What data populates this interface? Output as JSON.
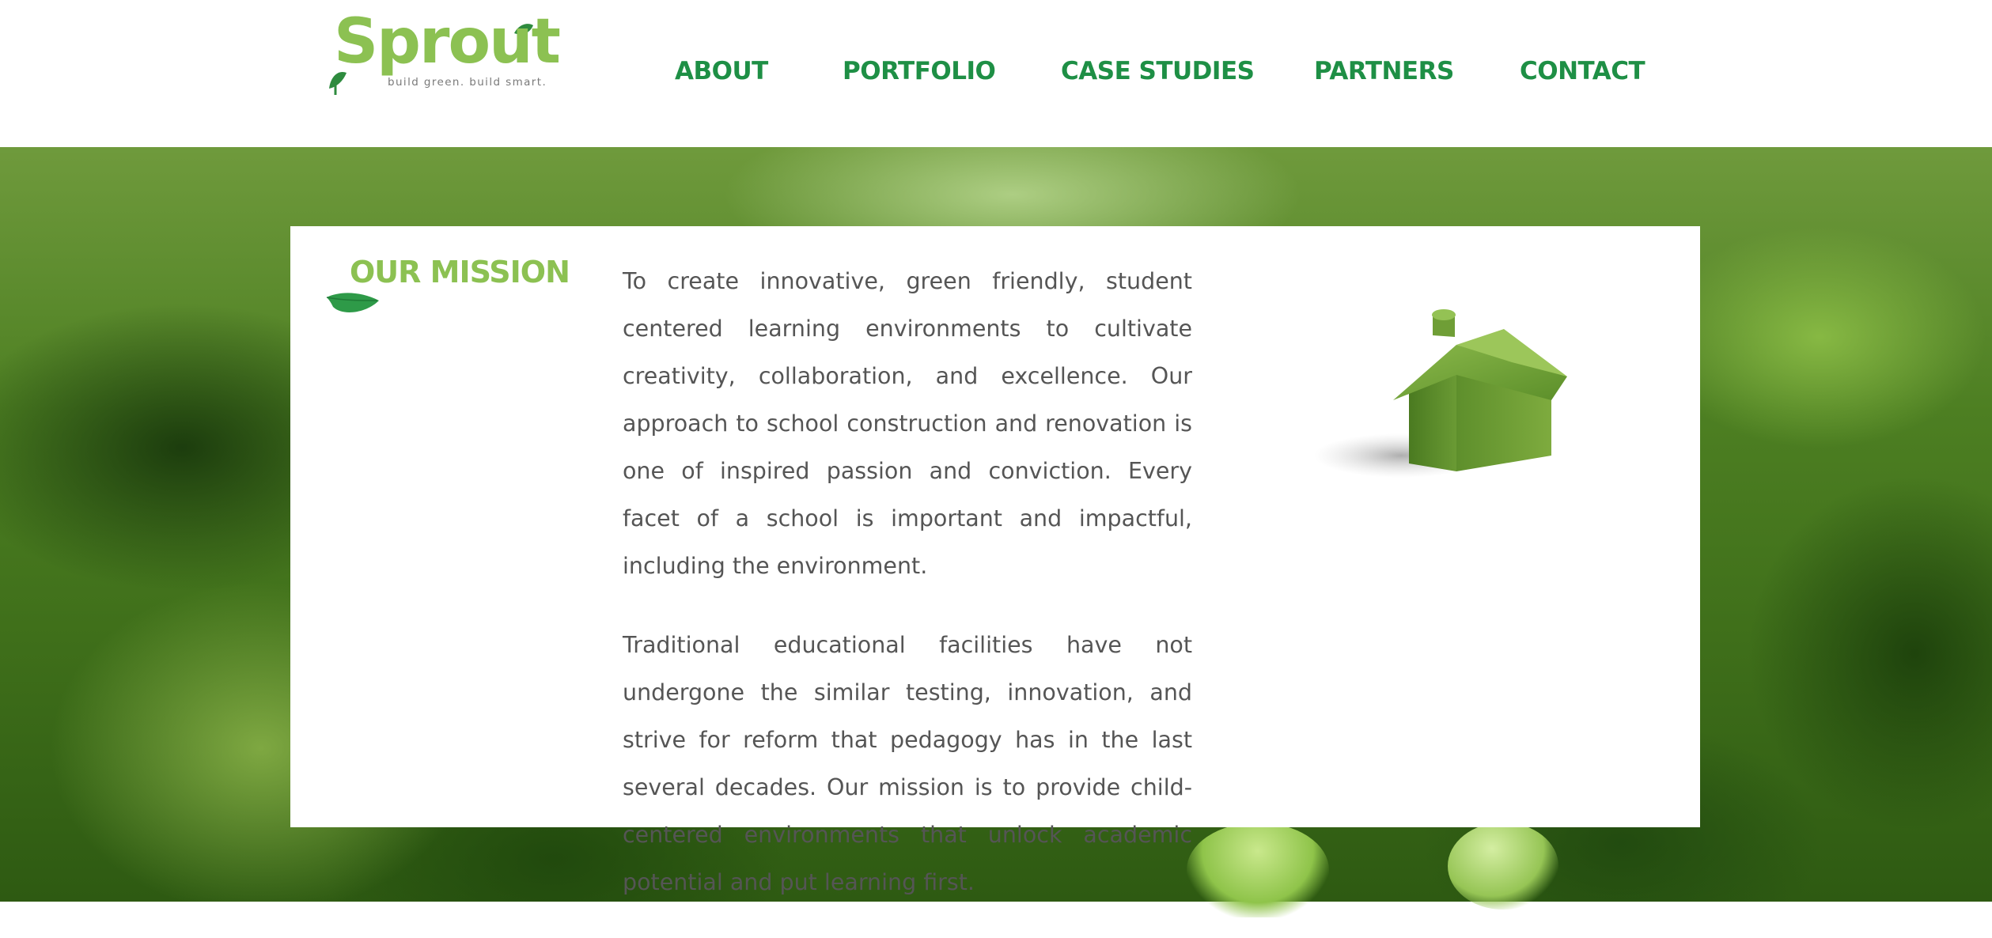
{
  "brand": {
    "logo_word": "Sprout",
    "tagline": "build green. build smart."
  },
  "nav": {
    "items": [
      {
        "label": "ABOUT"
      },
      {
        "label": "PORTFOLIO"
      },
      {
        "label": "CASE STUDIES"
      },
      {
        "label": "PARTNERS"
      },
      {
        "label": "CONTACT"
      }
    ]
  },
  "mission": {
    "title": "OUR MISSION",
    "paragraphs": [
      "To create innovative, green friendly, student centered learning environments to cultivate creativity, collaboration, and excellence. Our approach to school construction and renovation is one of inspired passion and conviction. Every facet of a school is important and impactful, including the environment.",
      "Traditional educational facilities have not undergone the similar testing, innovation, and strive for reform that pedagogy has in the last several decades. Our mission is to provide child-centered environments that unlock academic potential and put learning first."
    ],
    "image": "grass-house-icon"
  },
  "colors": {
    "nav": "#1e8f45",
    "brand_light_green": "#8cc152",
    "body_text": "#555555",
    "card_bg": "#ffffff"
  }
}
